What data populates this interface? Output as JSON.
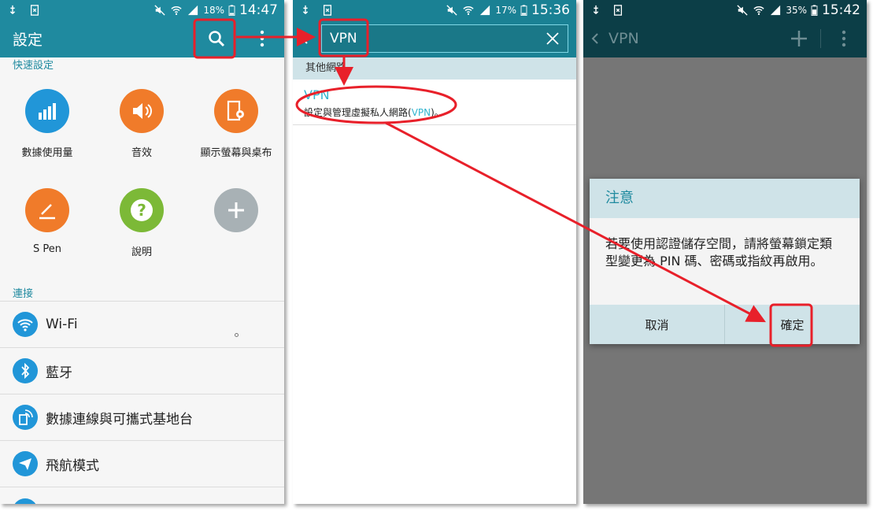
{
  "panel1": {
    "status": {
      "battery": "18%",
      "time": "14:47"
    },
    "title": "設定",
    "quick_settings_label": "快速設定",
    "quick_settings": [
      {
        "label": "數據使用量",
        "color": "#2196d8",
        "icon": "data-usage-icon"
      },
      {
        "label": "音效",
        "color": "#f07b2a",
        "icon": "sound-icon"
      },
      {
        "label": "顯示螢幕與桌布",
        "color": "#f07b2a",
        "icon": "display-icon"
      },
      {
        "label": "S Pen",
        "color": "#f07b2a",
        "icon": "pen-icon"
      },
      {
        "label": "說明",
        "color": "#7cb937",
        "icon": "help-icon"
      },
      {
        "label": "",
        "color": "#a8b1b5",
        "icon": "add-icon"
      }
    ],
    "connections_label": "連接",
    "connections": [
      {
        "label": "Wi-Fi",
        "icon": "wifi-icon"
      },
      {
        "label": "藍牙",
        "icon": "bluetooth-icon"
      },
      {
        "label": "數據連線與可攜式基地台",
        "icon": "tethering-icon"
      },
      {
        "label": "飛航模式",
        "icon": "airplane-icon"
      }
    ]
  },
  "panel2": {
    "status": {
      "battery": "17%",
      "time": "15:36"
    },
    "search_value": "VPN",
    "group_header": "其他網路",
    "result": {
      "title": "VPN",
      "desc_before": "設定與管理虛擬私人網路(",
      "desc_highlight": "VPN",
      "desc_after": ")。"
    }
  },
  "panel3": {
    "status": {
      "battery": "35%",
      "time": "15:42"
    },
    "title": "VPN",
    "dialog": {
      "title": "注意",
      "message": "若要使用認證儲存空間，請將螢幕鎖定類型變更為 PIN 碼、密碼或指紋再啟用。",
      "cancel": "取消",
      "ok": "確定"
    }
  },
  "colors": {
    "teal": "#1f8a9f",
    "accent": "#34b5cf",
    "annotation": "#e8202a"
  }
}
